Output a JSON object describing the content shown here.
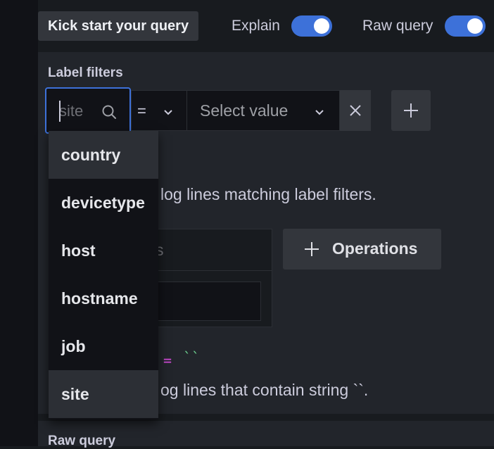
{
  "toolbar": {
    "kick_start_label": "Kick start your query",
    "explain_label": "Explain",
    "raw_query_label": "Raw query",
    "explain_on": true,
    "raw_query_on": true
  },
  "label_filters": {
    "title": "Label filters",
    "search_value": "site",
    "operator": "=",
    "value_placeholder": "Select value",
    "description": "log lines matching label filters."
  },
  "operations": {
    "input_placeholder": "s",
    "button_label": "Operations"
  },
  "line_filter": {
    "operator_code": "=",
    "value_code": "``",
    "description": "og lines that contain string ``."
  },
  "raw_query": {
    "title": "Raw query"
  },
  "dropdown": {
    "items": [
      {
        "label": "country",
        "highlighted": true
      },
      {
        "label": "devicetype",
        "highlighted": false
      },
      {
        "label": "host",
        "highlighted": false
      },
      {
        "label": "hostname",
        "highlighted": false
      },
      {
        "label": "job",
        "highlighted": false
      },
      {
        "label": "site",
        "highlighted": true
      }
    ]
  },
  "colors": {
    "background": "#181b1f",
    "panel": "#22252b",
    "accent": "#3d71d9",
    "button": "#33363c"
  }
}
